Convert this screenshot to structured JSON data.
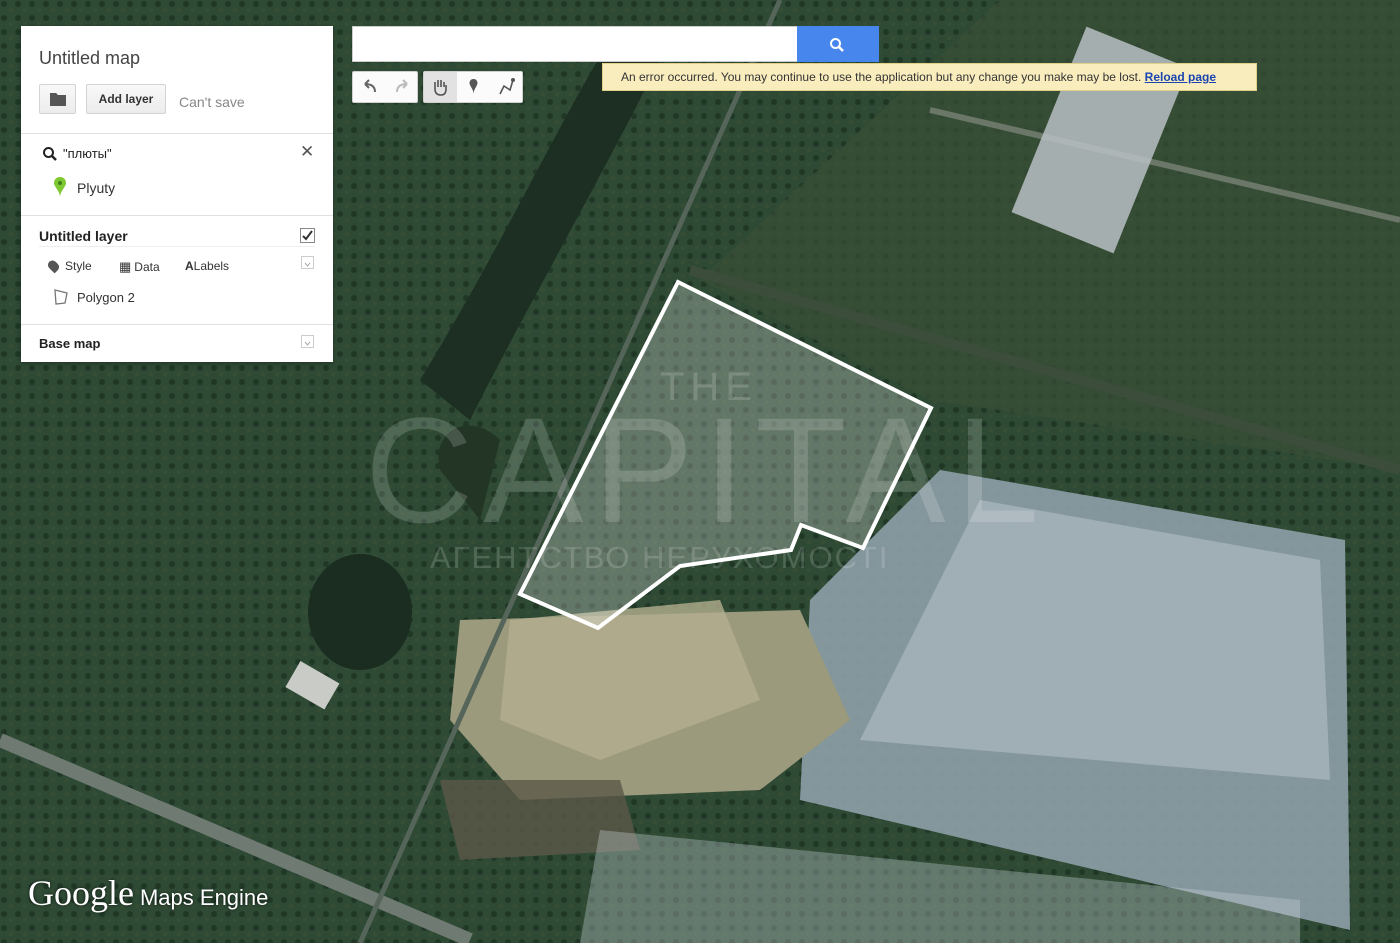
{
  "map": {
    "type": "satellite",
    "polygon": {
      "name": "Polygon 2",
      "stroke": "#ffffff",
      "fill": "rgba(255,255,255,0.25)"
    }
  },
  "panel": {
    "map_title": "Untitled map",
    "add_layer_label": "Add layer",
    "cant_save": "Can't save",
    "search_result": {
      "query": "\"плюты\"",
      "place": "Plyuty",
      "pin_color": "#7ec832"
    },
    "layer": {
      "title": "Untitled layer",
      "checked": true,
      "tools": [
        {
          "icon": "style-pin-icon",
          "label": "Style"
        },
        {
          "icon": "table-icon",
          "label": "Data"
        },
        {
          "icon": "labels-icon",
          "label": "Labels"
        }
      ],
      "feature": "Polygon 2"
    },
    "basemap_label": "Base map"
  },
  "search": {
    "value": "",
    "button_color": "#4787ed"
  },
  "error": {
    "message": "An error occurred. You may continue to use the application but any change you make may be lost.",
    "link": "Reload page"
  },
  "footer": {
    "brand": "Google",
    "product": "Maps Engine"
  },
  "watermark": {
    "top": "THE",
    "main": "CAPITAL",
    "sub": "АГЕНТСТВО НЕРУХОМОСТІ"
  }
}
